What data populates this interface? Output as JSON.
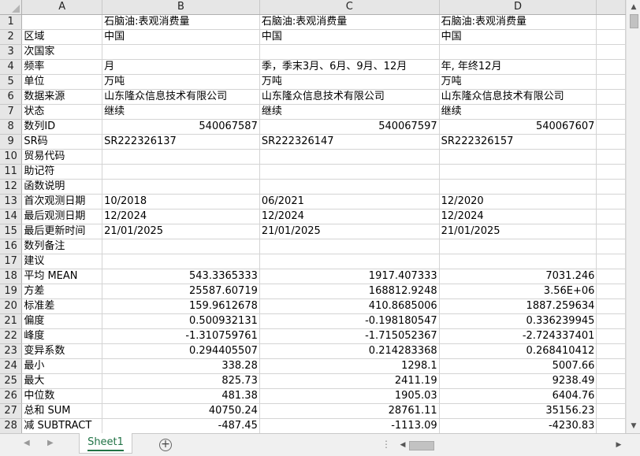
{
  "columns": [
    "A",
    "B",
    "C",
    "D"
  ],
  "rows": [
    {
      "n": "1",
      "a": "",
      "b": "石脑油:表观消费量",
      "c": "石脑油:表观消费量",
      "d": "石脑油:表观消费量"
    },
    {
      "n": "2",
      "a": "区域",
      "b": "中国",
      "c": "中国",
      "d": "中国"
    },
    {
      "n": "3",
      "a": "次国家",
      "b": "",
      "c": "",
      "d": ""
    },
    {
      "n": "4",
      "a": "频率",
      "b": "月",
      "c": "季，季末3月、6月、9月、12月",
      "d": "年, 年终12月"
    },
    {
      "n": "5",
      "a": "单位",
      "b": "万吨",
      "c": "万吨",
      "d": "万吨"
    },
    {
      "n": "6",
      "a": "数据来源",
      "b": "山东隆众信息技术有限公司",
      "c": "山东隆众信息技术有限公司",
      "d": "山东隆众信息技术有限公司"
    },
    {
      "n": "7",
      "a": "状态",
      "b": "继续",
      "c": "继续",
      "d": "继续"
    },
    {
      "n": "8",
      "a": "数列ID",
      "b": "540067587",
      "c": "540067597",
      "d": "540067607",
      "num": true
    },
    {
      "n": "9",
      "a": "SR码",
      "b": "SR222326137",
      "c": "SR222326147",
      "d": "SR222326157"
    },
    {
      "n": "10",
      "a": "贸易代码",
      "b": "",
      "c": "",
      "d": ""
    },
    {
      "n": "11",
      "a": "助记符",
      "b": "",
      "c": "",
      "d": ""
    },
    {
      "n": "12",
      "a": "函数说明",
      "b": "",
      "c": "",
      "d": ""
    },
    {
      "n": "13",
      "a": "首次观测日期",
      "b": "10/2018",
      "c": "06/2021",
      "d": "12/2020"
    },
    {
      "n": "14",
      "a": "最后观测日期",
      "b": "12/2024",
      "c": "12/2024",
      "d": "12/2024"
    },
    {
      "n": "15",
      "a": "最后更新时间",
      "b": "21/01/2025",
      "c": "21/01/2025",
      "d": "21/01/2025"
    },
    {
      "n": "16",
      "a": "数列备注",
      "b": "",
      "c": "",
      "d": ""
    },
    {
      "n": "17",
      "a": "建议",
      "b": "",
      "c": "",
      "d": ""
    },
    {
      "n": "18",
      "a": "平均 MEAN",
      "b": "543.3365333",
      "c": "1917.407333",
      "d": "7031.246",
      "num": true
    },
    {
      "n": "19",
      "a": "方差",
      "b": "25587.60719",
      "c": "168812.9248",
      "d": "3.56E+06",
      "num": true
    },
    {
      "n": "20",
      "a": "标准差",
      "b": "159.9612678",
      "c": "410.8685006",
      "d": "1887.259634",
      "num": true
    },
    {
      "n": "21",
      "a": "偏度",
      "b": "0.500932131",
      "c": "-0.198180547",
      "d": "0.336239945",
      "num": true
    },
    {
      "n": "22",
      "a": "峰度",
      "b": "-1.310759761",
      "c": "-1.715052367",
      "d": "-2.724337401",
      "num": true
    },
    {
      "n": "23",
      "a": "变异系数",
      "b": "0.294405507",
      "c": "0.214283368",
      "d": "0.268410412",
      "num": true
    },
    {
      "n": "24",
      "a": "最小",
      "b": "338.28",
      "c": "1298.1",
      "d": "5007.66",
      "num": true
    },
    {
      "n": "25",
      "a": "最大",
      "b": "825.73",
      "c": "2411.19",
      "d": "9238.49",
      "num": true
    },
    {
      "n": "26",
      "a": "中位数",
      "b": "481.38",
      "c": "1905.03",
      "d": "6404.76",
      "num": true
    },
    {
      "n": "27",
      "a": "总和 SUM",
      "b": "40750.24",
      "c": "28761.11",
      "d": "35156.23",
      "num": true
    },
    {
      "n": "28",
      "a": "减 SUBTRACT",
      "b": "-487.45",
      "c": "-1113.09",
      "d": "-4230.83",
      "num": true
    }
  ],
  "sheet_tab": "Sheet1",
  "add_sheet_symbol": "+",
  "accent_color": "#217346"
}
